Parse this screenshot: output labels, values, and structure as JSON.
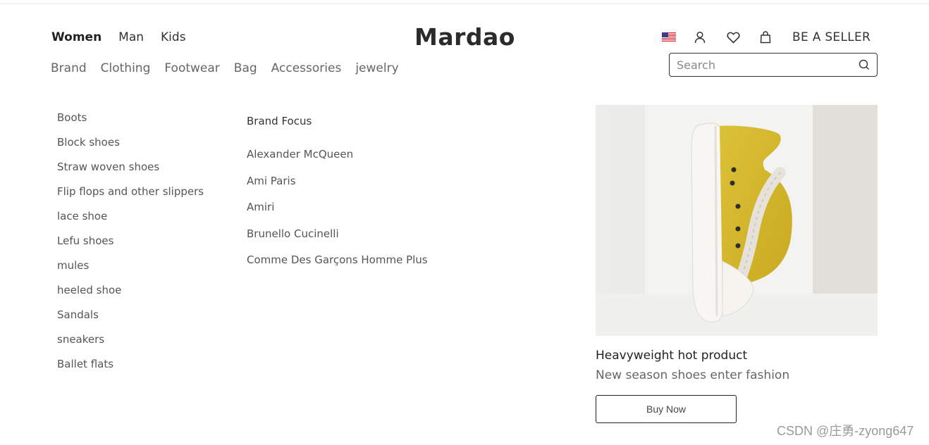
{
  "header": {
    "gender_tabs": [
      {
        "label": "Women",
        "active": true
      },
      {
        "label": "Man",
        "active": false
      },
      {
        "label": "Kids",
        "active": false
      }
    ],
    "logo": "Mardao",
    "categories": [
      "Brand",
      "Clothing",
      "Footwear",
      "Bag",
      "Accessories",
      "jewelry"
    ],
    "utilities": {
      "flag_icon": "us-flag-icon",
      "user_icon": "user-icon",
      "wishlist_icon": "heart-icon",
      "cart_icon": "shopping-bag-icon",
      "seller_label": "BE A SELLER"
    },
    "search": {
      "placeholder": "Search",
      "value": "",
      "icon": "search-icon"
    }
  },
  "menu": {
    "footwear_types": [
      "Boots",
      "Block shoes",
      "Straw woven shoes",
      "Flip flops and other slippers",
      "lace shoe",
      "Lefu shoes",
      "mules",
      "heeled shoe",
      "Sandals",
      "sneakers",
      "Ballet flats"
    ],
    "brand_focus": {
      "heading": "Brand Focus",
      "brands": [
        "Alexander McQueen",
        "Ami Paris",
        "Amiri",
        "Brunello Cucinelli",
        "Comme Des Garçons Homme Plus"
      ]
    }
  },
  "promo": {
    "title": "Heavyweight hot product",
    "subtitle": "New season shoes enter fashion",
    "button_label": "Buy Now",
    "image": "yellow-high-top-sneaker-photo"
  },
  "watermark": "CSDN @庄勇-zyong647",
  "colors": {
    "text": "#333333",
    "muted": "#666666",
    "border": "#222222",
    "sneaker_yellow": "#d6b82b"
  }
}
